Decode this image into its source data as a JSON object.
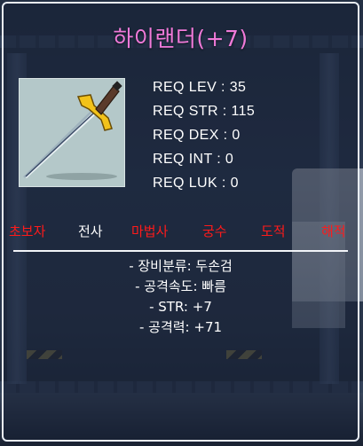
{
  "item": {
    "name": "하이랜더(+7)",
    "name_color": "#f07ad9",
    "icon": "two-handed-sword-icon"
  },
  "requirements": [
    {
      "label": "REQ LEV",
      "value": "35",
      "text": "REQ LEV : 35"
    },
    {
      "label": "REQ STR",
      "value": "115",
      "text": "REQ STR : 115"
    },
    {
      "label": "REQ DEX",
      "value": "0",
      "text": "REQ DEX : 0"
    },
    {
      "label": "REQ INT",
      "value": "0",
      "text": "REQ INT : 0"
    },
    {
      "label": "REQ LUK",
      "value": "0",
      "text": "REQ LUK : 0"
    }
  ],
  "jobs": [
    {
      "name": "초보자",
      "available": false,
      "color": "#ff1a1a"
    },
    {
      "name": "전사",
      "available": true,
      "color": "#ffffff"
    },
    {
      "name": "마법사",
      "available": false,
      "color": "#ff1a1a"
    },
    {
      "name": "궁수",
      "available": false,
      "color": "#ff1a1a"
    },
    {
      "name": "도적",
      "available": false,
      "color": "#ff1a1a"
    },
    {
      "name": "해적",
      "available": false,
      "color": "#ff1a1a"
    }
  ],
  "properties": [
    "- 장비분류: 두손검",
    "- 공격속도: 빠름",
    "- STR: +7",
    "- 공격력: +71"
  ]
}
